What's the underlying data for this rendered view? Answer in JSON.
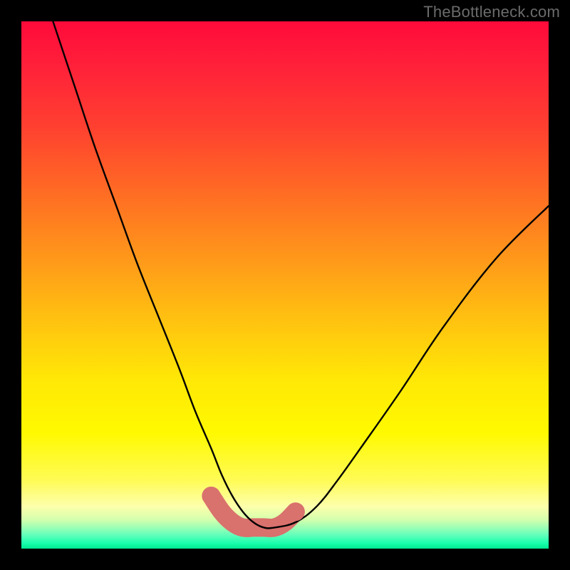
{
  "watermark": "TheBottleneck.com",
  "chart_data": {
    "type": "line",
    "title": "",
    "xlabel": "",
    "ylabel": "",
    "xlim": [
      0,
      100
    ],
    "ylim": [
      0,
      100
    ],
    "series": [
      {
        "name": "main-curve",
        "color": "#000000",
        "x": [
          6,
          10,
          14,
          18,
          22,
          26,
          30,
          33,
          36,
          38,
          40,
          42,
          44,
          46,
          48,
          52,
          56,
          60,
          65,
          72,
          80,
          90,
          100
        ],
        "values": [
          100,
          88,
          76,
          65,
          54,
          44,
          34,
          26,
          19,
          14,
          10,
          7,
          5,
          4,
          4,
          5,
          8,
          13,
          20,
          30,
          42,
          55,
          65
        ]
      },
      {
        "name": "valley-band",
        "color": "#d9716d",
        "x": [
          36,
          38,
          40,
          42,
          44,
          46,
          48,
          50,
          52
        ],
        "values": [
          10,
          7,
          5,
          4,
          4,
          4,
          4,
          5,
          7
        ]
      }
    ],
    "background_gradient": {
      "top": "#ff0a3a",
      "mid1": "#ff981a",
      "mid2": "#fff900",
      "bottom": "#00e890"
    }
  }
}
